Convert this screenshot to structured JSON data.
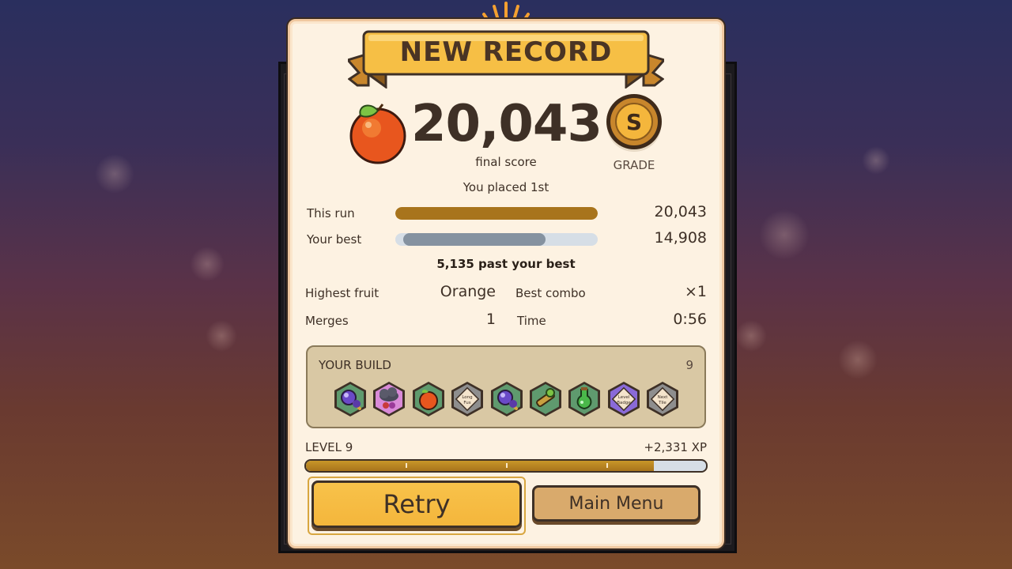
{
  "banner": {
    "title": "NEW RECORD"
  },
  "score": {
    "value": "20,043",
    "label": "final score"
  },
  "grade": {
    "letter": "S",
    "label": "GRADE"
  },
  "placement": "You placed 1st",
  "comparison": {
    "this_run": {
      "label": "This run",
      "value": "20,043",
      "fraction": 1.0
    },
    "your_best": {
      "label": "Your best",
      "value": "14,908",
      "fraction": 0.744
    },
    "difference": "5,135 past your best"
  },
  "stats": {
    "highest_fruit": {
      "label": "Highest fruit",
      "value": "Orange"
    },
    "best_combo": {
      "label": "Best combo",
      "value": "×1"
    },
    "merges": {
      "label": "Merges",
      "value": "1"
    },
    "time": {
      "label": "Time",
      "value": "0:56"
    }
  },
  "build": {
    "title": "YOUR BUILD",
    "count": "9",
    "items": [
      {
        "icon": "magnifier-berry-icon",
        "color": "#5f9a6e",
        "text": ""
      },
      {
        "icon": "storm-cloud-icon",
        "color": "#d98ad8",
        "text": ""
      },
      {
        "icon": "orange-fruit-icon",
        "color": "#5f9a6e",
        "text": ""
      },
      {
        "icon": "placeholder-card-icon",
        "color": "#8e8e8e",
        "text": "Long Fus"
      },
      {
        "icon": "magnifier-berry-icon",
        "color": "#5f9a6e",
        "text": ""
      },
      {
        "icon": "spyglass-icon",
        "color": "#5f9a6e",
        "text": ""
      },
      {
        "icon": "green-potion-icon",
        "color": "#5f9a6e",
        "text": ""
      },
      {
        "icon": "placeholder-card-icon",
        "color": "#8a6ad8",
        "text": "Level Badge"
      },
      {
        "icon": "placeholder-card-icon",
        "color": "#8e8e8e",
        "text": "Next Tile"
      }
    ]
  },
  "level": {
    "label": "LEVEL 9",
    "xp": "+2,331 XP",
    "progress": 0.87
  },
  "buttons": {
    "retry": "Retry",
    "main_menu": "Main Menu"
  },
  "colors": {
    "this_run_bar": "#a8741c",
    "best_bar": "#8592a0",
    "best_track": "#d6dee6",
    "accent": "#f4b63c"
  }
}
